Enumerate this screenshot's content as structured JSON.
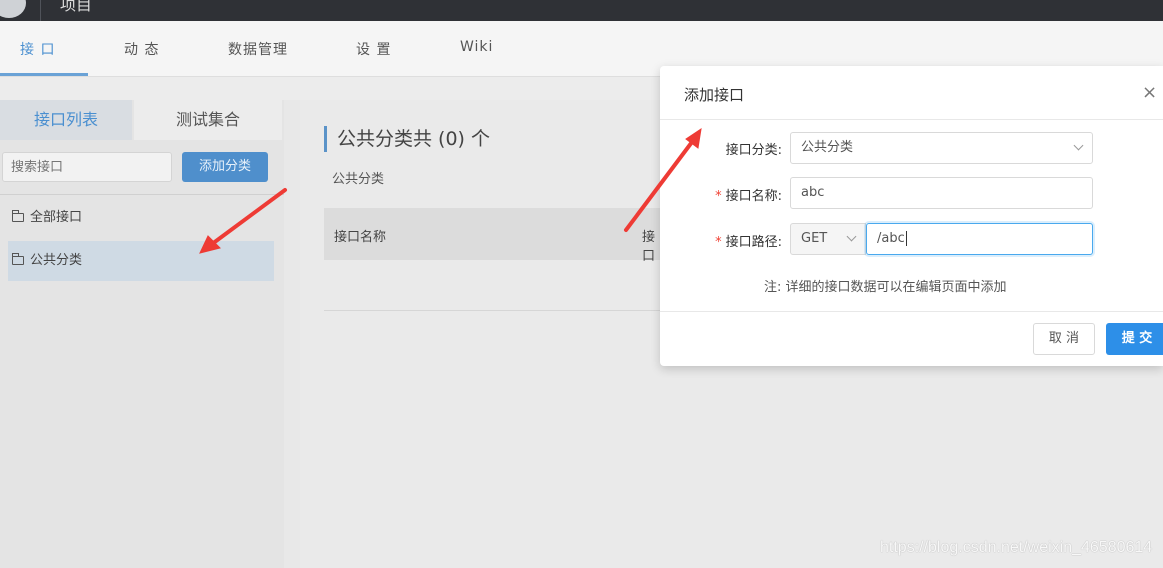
{
  "topbar": {
    "project_name": "项目"
  },
  "nav": {
    "tabs": [
      "接 口",
      "动 态",
      "数据管理",
      "设 置",
      "Wiki"
    ]
  },
  "left": {
    "tabs": [
      "接口列表",
      "测试集合"
    ],
    "search_placeholder": "搜索接口",
    "add_category": "添加分类",
    "tree": [
      "全部接口",
      "公共分类"
    ]
  },
  "main": {
    "title": "公共分类共 (0) 个",
    "subtitle": "公共分类",
    "columns": [
      "接口名称",
      "接口"
    ]
  },
  "modal": {
    "title": "添加接口",
    "close": "×",
    "category_label": "接口分类:",
    "category_value": "公共分类",
    "name_label": "接口名称:",
    "name_value": "abc",
    "path_label": "接口路径:",
    "method_value": "GET",
    "path_value": "/abc",
    "note": "注: 详细的接口数据可以在编辑页面中添加",
    "cancel": "取 消",
    "submit": "提 交"
  },
  "watermark": "https://blog.csdn.net/weixin_46580614",
  "colors": {
    "accent": "#2d8fe8",
    "annotation_arrow": "#ee3b35"
  }
}
